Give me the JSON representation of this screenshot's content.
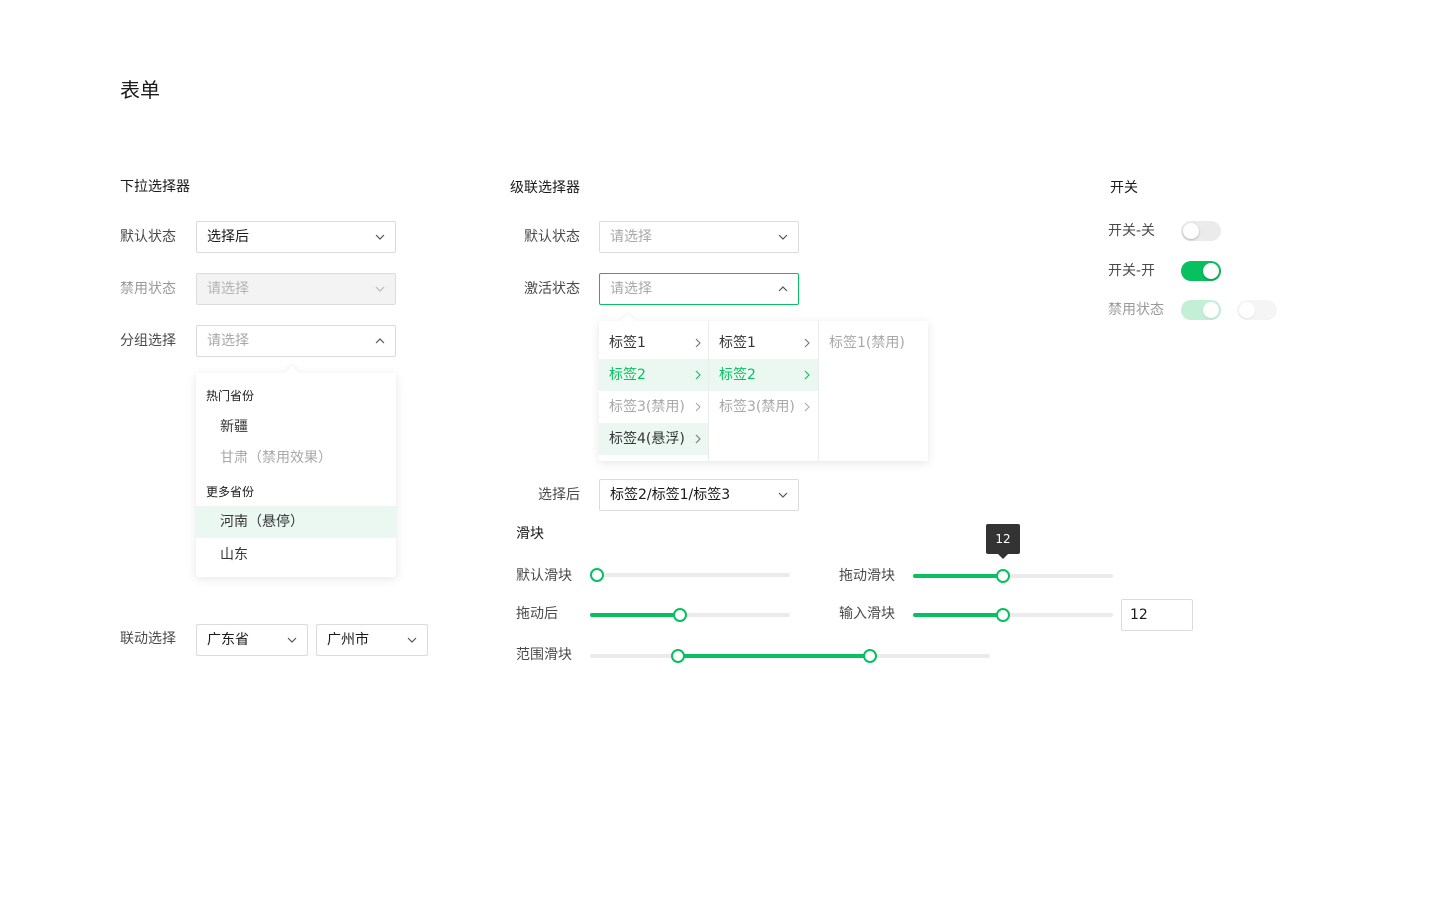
{
  "page_title": "表单",
  "dropdown": {
    "section_title": "下拉选择器",
    "default": {
      "label": "默认状态",
      "value": "选择后"
    },
    "disabled": {
      "label": "禁用状态",
      "placeholder": "请选择"
    },
    "group": {
      "label": "分组选择",
      "placeholder": "请选择",
      "groups": [
        {
          "title": "热门省份",
          "options": [
            {
              "label": "新疆"
            },
            {
              "label": "甘肃（禁用效果）"
            }
          ]
        },
        {
          "title": "更多省份",
          "options": [
            {
              "label": "河南（悬停）"
            },
            {
              "label": "山东"
            }
          ]
        }
      ]
    },
    "linked": {
      "label": "联动选择",
      "province": "广东省",
      "city": "广州市"
    }
  },
  "cascader": {
    "section_title": "级联选择器",
    "default": {
      "label": "默认状态",
      "placeholder": "请选择"
    },
    "active": {
      "label": "激活状态",
      "placeholder": "请选择",
      "columns": [
        [
          {
            "label": "标签1"
          },
          {
            "label": "标签2"
          },
          {
            "label": "标签3(禁用)"
          },
          {
            "label": "标签4(悬浮)"
          }
        ],
        [
          {
            "label": "标签1"
          },
          {
            "label": "标签2"
          },
          {
            "label": "标签3(禁用)"
          }
        ],
        [
          {
            "label": "标签1(禁用)"
          }
        ]
      ]
    },
    "selected": {
      "label": "选择后",
      "value": "标签2/标签1/标签3"
    }
  },
  "switches": {
    "section_title": "开关",
    "off": {
      "label": "开关-关",
      "on": false
    },
    "on": {
      "label": "开关-开",
      "on": true
    },
    "disabled": {
      "label": "禁用状态"
    }
  },
  "slider": {
    "section_title": "滑块",
    "default": {
      "label": "默认滑块",
      "fraction": 0.0
    },
    "dragging": {
      "label": "拖动滑块",
      "fraction": 0.45,
      "tooltip": "12"
    },
    "after_drag": {
      "label": "拖动后",
      "fraction": 0.45
    },
    "with_input": {
      "label": "输入滑块",
      "fraction": 0.45,
      "input_value": "12"
    },
    "range": {
      "label": "范围滑块",
      "start_fraction": 0.22,
      "end_fraction": 0.7
    }
  },
  "colors": {
    "accent": "#07c160",
    "accent_light": "#ebf8f1",
    "border": "#dcdcdc"
  }
}
